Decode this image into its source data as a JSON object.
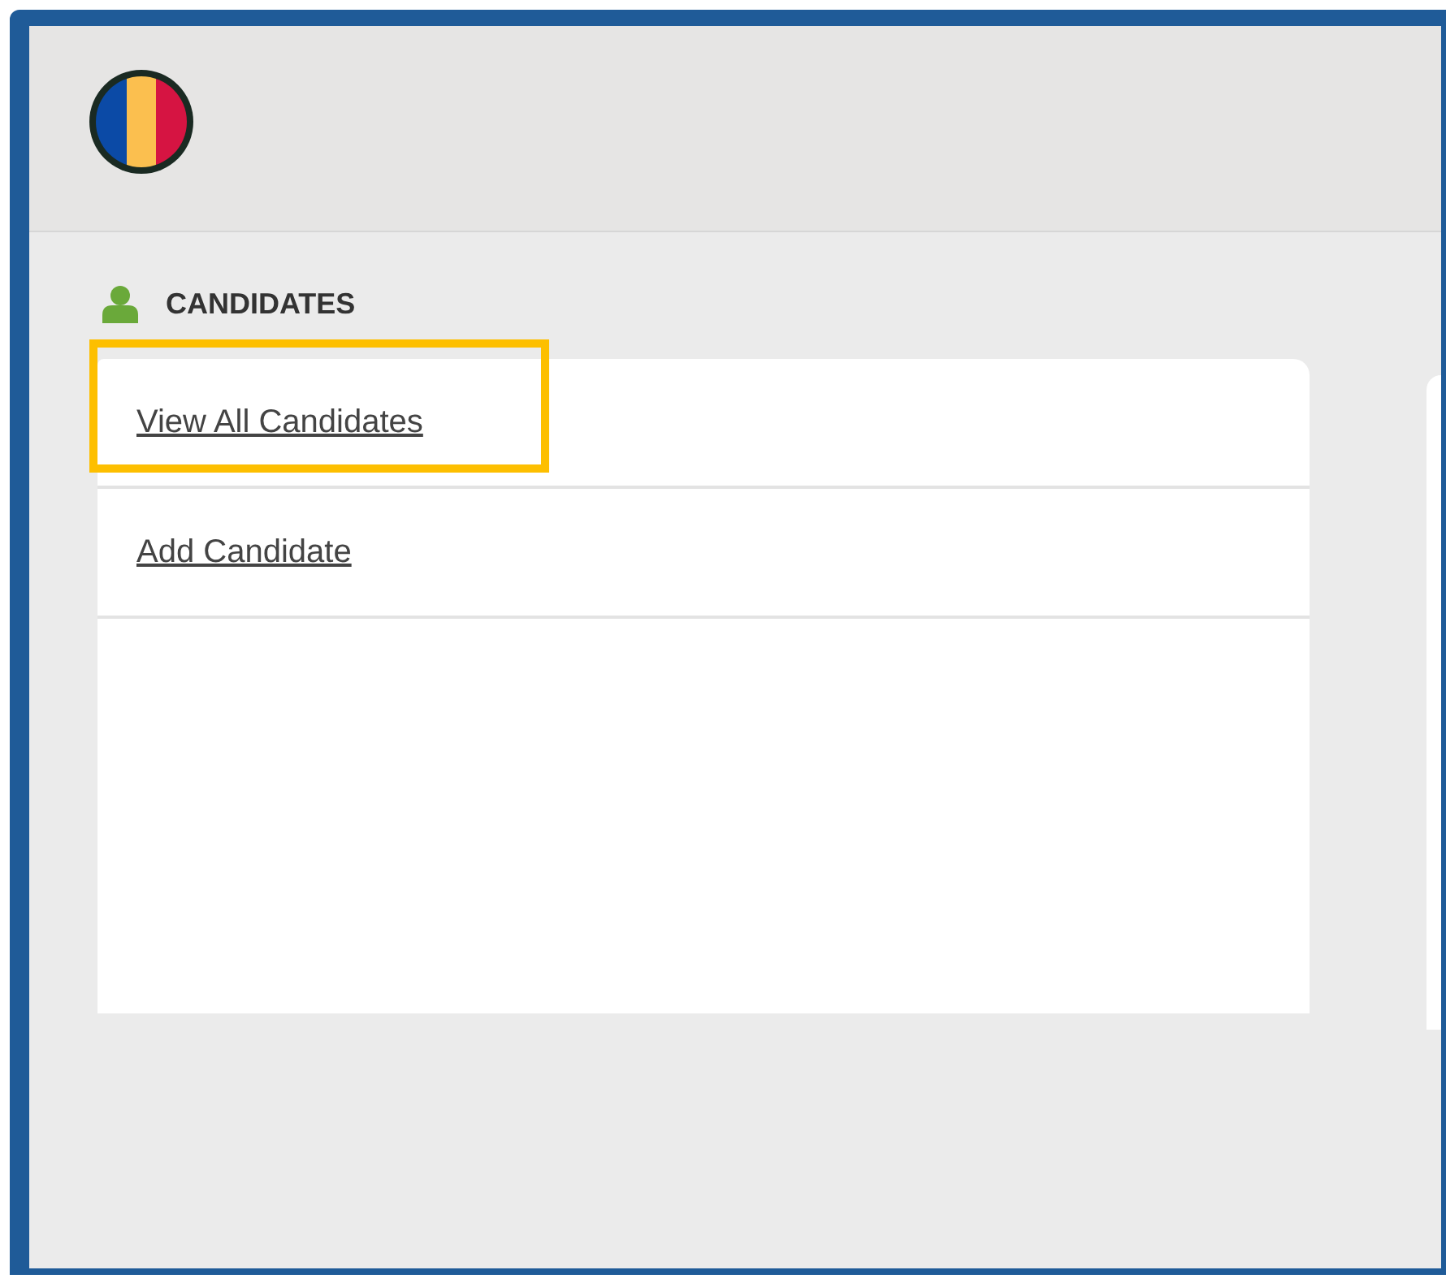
{
  "section": {
    "title": "CANDIDATES"
  },
  "menu": [
    {
      "label": "View All Candidates",
      "highlighted": true
    },
    {
      "label": "Add Candidate",
      "highlighted": false
    }
  ]
}
